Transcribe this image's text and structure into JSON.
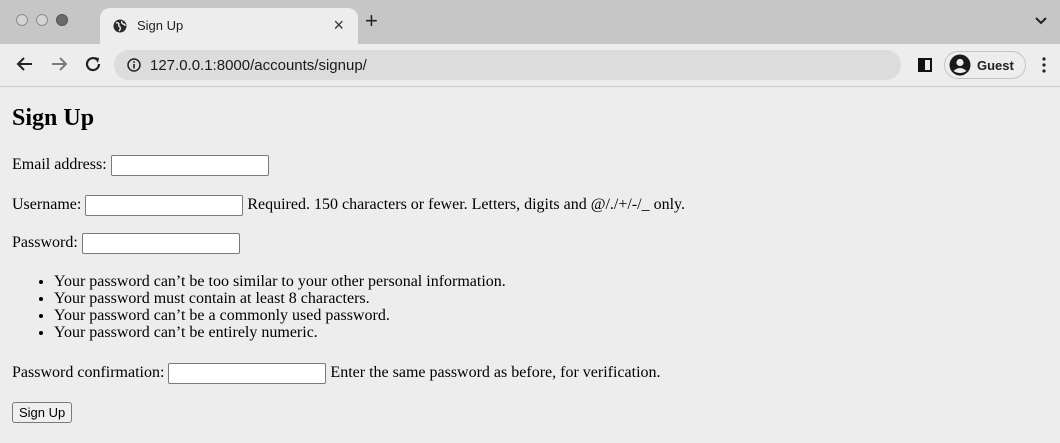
{
  "browser": {
    "tab_title": "Sign Up",
    "tab_close": "×",
    "new_tab": "+",
    "url": "127.0.0.1:8000/accounts/signup/",
    "profile_label": "Guest"
  },
  "icons": {
    "tab_favicon": "globe-icon",
    "tab_menu": "chevron-down-icon",
    "back": "arrow-left-icon",
    "forward": "arrow-right-icon",
    "reload": "reload-icon",
    "site_info": "info-icon",
    "side_panel": "side-panel-icon",
    "profile": "avatar-icon",
    "menu": "kebab-menu-icon"
  },
  "page": {
    "heading": "Sign Up",
    "email": {
      "label": "Email address:",
      "value": ""
    },
    "username": {
      "label": "Username:",
      "value": "",
      "help": "Required. 150 characters or fewer. Letters, digits and @/./+/-/_ only."
    },
    "password": {
      "label": "Password:",
      "value": "",
      "rules": [
        "Your password can’t be too similar to your other personal information.",
        "Your password must contain at least 8 characters.",
        "Your password can’t be a commonly used password.",
        "Your password can’t be entirely numeric."
      ]
    },
    "password_confirmation": {
      "label": "Password confirmation:",
      "value": "",
      "help": "Enter the same password as before, for verification."
    },
    "submit_label": "Sign Up"
  }
}
